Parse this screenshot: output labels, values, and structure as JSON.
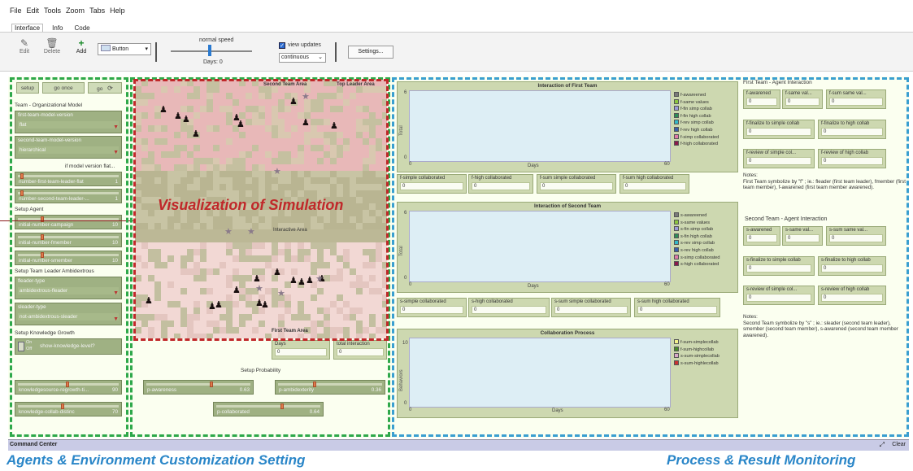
{
  "menu": [
    "File",
    "Edit",
    "Tools",
    "Zoom",
    "Tabs",
    "Help"
  ],
  "tabs": [
    "Interface",
    "Info",
    "Code"
  ],
  "toolbar": {
    "edit": "Edit",
    "delete": "Delete",
    "add": "Add",
    "widget_type": "Button",
    "speed_label": "normal speed",
    "days_label": "Days: 0",
    "view_updates": "view updates",
    "update_mode": "continuous",
    "settings": "Settings..."
  },
  "controls": {
    "setup": "setup",
    "go_once": "go once",
    "go": "go",
    "org_model_title": "Team - Organizational Model",
    "first_team_model": {
      "label": "first-team-model-version",
      "value": "flat"
    },
    "second_team_model": {
      "label": "second-team-model-version",
      "value": "hierarchical"
    },
    "if_flat_note": "if model version flat...",
    "slider_leader_flat": {
      "label": "number-first-team-leader-flat",
      "value": "1",
      "level": 0.05
    },
    "slider_second_leader": {
      "label": "number-second-team-leader-...",
      "value": "1",
      "level": 0.05
    },
    "setup_agent_title": "Setup Agent",
    "slider_campaign": {
      "label": "initial-number-campaign",
      "value": "10",
      "level": 0.25
    },
    "slider_fmember": {
      "label": "initial-number-fmember",
      "value": "10",
      "level": 0.25
    },
    "slider_smember": {
      "label": "initial-number-smember",
      "value": "10",
      "level": 0.25
    },
    "ambidextrous_title": "Setup Team Leader Ambidextrous",
    "fleader_type": {
      "label": "fleader-type",
      "value": "ambidextrous-fleader"
    },
    "sleader_type": {
      "label": "sleader-type",
      "value": "not-ambidextrous-sleader"
    },
    "knowledge_title": "Setup Knowledge Growth",
    "switch_on": "On",
    "switch_off": "Off",
    "show_knowledge": "show-knowledge-level?",
    "slider_regrowth": {
      "label": "knowledgesource-regrowth-ti...",
      "value": "90",
      "level": 0.5
    },
    "slider_distinc": {
      "label": "knowledge-collab-distinc",
      "value": "70",
      "level": 0.45
    }
  },
  "world": {
    "second_area": "Second Team Area",
    "top_leader": "Top Leader Area",
    "interactive": "Interactive Area",
    "first_area": "First Team Area",
    "overlay": "Visualization of Simulation"
  },
  "probability": {
    "days_label": "Days",
    "days_value": "0",
    "total_label": "total interaction",
    "total_value": "0",
    "title": "Setup Probability",
    "p_awareness": {
      "label": "p-awareness",
      "value": "0.63",
      "level": 0.63
    },
    "p_ambidexterity": {
      "label": "p-ambidexterity",
      "value": "0.36",
      "level": 0.36
    },
    "p_collaborated": {
      "label": "p-collaborated",
      "value": "0.64",
      "level": 0.64
    }
  },
  "plot1": {
    "title": "Interaction of First Team",
    "ylabel": "Total",
    "xlabel": "Days",
    "ymax": "6",
    "ymin": "0",
    "xmin": "0",
    "xmax": "60",
    "legend": [
      {
        "name": "f-awareened",
        "color": "#7a7a7a"
      },
      {
        "name": "f-same values",
        "color": "#8cc63f"
      },
      {
        "name": "f-fin simp collab",
        "color": "#9a9ad8"
      },
      {
        "name": "f-fin high collab",
        "color": "#2e8b57"
      },
      {
        "name": "f-rev simp collab",
        "color": "#35b8c8"
      },
      {
        "name": "f-rev high collab",
        "color": "#3a5fa8"
      },
      {
        "name": "f-simp collaborated",
        "color": "#e07aa8"
      },
      {
        "name": "f-high collaborated",
        "color": "#8b1a4a"
      }
    ]
  },
  "monitors1": [
    {
      "label": "f-simple collaborated",
      "value": "0"
    },
    {
      "label": "f-high collaborated",
      "value": "0"
    },
    {
      "label": "f-sum simple collaborated",
      "value": "0"
    },
    {
      "label": "f-sum high collaborated",
      "value": "0"
    }
  ],
  "plot2": {
    "title": "Interaction of Second Team",
    "ylabel": "Total",
    "xlabel": "Days",
    "ymax": "6",
    "ymin": "0",
    "xmin": "0",
    "xmax": "60",
    "legend": [
      {
        "name": "s-awareened",
        "color": "#7a7a7a"
      },
      {
        "name": "s-same values",
        "color": "#8cc63f"
      },
      {
        "name": "s-fin simp collab",
        "color": "#9a9ad8"
      },
      {
        "name": "s-fin high collab",
        "color": "#2e8b57"
      },
      {
        "name": "s-rev simp collab",
        "color": "#35b8c8"
      },
      {
        "name": "s-rev high collab",
        "color": "#3a5fa8"
      },
      {
        "name": "s-simp collaborated",
        "color": "#e07aa8"
      },
      {
        "name": "s-high collaborated",
        "color": "#8b1a4a"
      }
    ]
  },
  "monitors2": [
    {
      "label": "s-simple collaborated",
      "value": "0"
    },
    {
      "label": "s-high collaborated",
      "value": "0"
    },
    {
      "label": "s-sum simple collaborated",
      "value": "0"
    },
    {
      "label": "s-sum high collaborated",
      "value": "0"
    }
  ],
  "plot3": {
    "title": "Collaboration Process",
    "ylabel": "Behaviors",
    "xlabel": "Days",
    "ymax": "10",
    "ymin": "0",
    "xmin": "0",
    "xmax": "60",
    "legend": [
      {
        "name": "f-sum-simplecollab",
        "color": "#f2f28c"
      },
      {
        "name": "f-sum-highcollab",
        "color": "#4a8c2a"
      },
      {
        "name": "s-sum-simplecollab",
        "color": "#d8a8c8"
      },
      {
        "name": "s-sum-highlecollab",
        "color": "#c83232"
      }
    ]
  },
  "first_interaction": {
    "title": "First Team - Agent Interaction",
    "row1": [
      {
        "label": "f-awarened",
        "value": "0"
      },
      {
        "label": "f-same val...",
        "value": "0"
      },
      {
        "label": "f-sum same val...",
        "value": "0"
      }
    ],
    "row2": [
      {
        "label": "f-finalize to simple collab",
        "value": "0"
      },
      {
        "label": "f-finalize to high collab",
        "value": "0"
      }
    ],
    "row3": [
      {
        "label": "f-review of simple col...",
        "value": "0"
      },
      {
        "label": "f-review of high collab",
        "value": "0"
      }
    ],
    "notes_title": "Notes:",
    "notes": "First Team symbolize by \"f\" ; ie.: fleader (first team leader), fmember (first team member), f-awarened (first team member awarened)."
  },
  "second_interaction": {
    "title": "Second Team - Agent Interaction",
    "row1": [
      {
        "label": "s-awarened",
        "value": "0"
      },
      {
        "label": "s-same val...",
        "value": "0"
      },
      {
        "label": "s-sum same val...",
        "value": "0"
      }
    ],
    "row2": [
      {
        "label": "s-finalize to simple collab",
        "value": "0"
      },
      {
        "label": "s-finalize to high collab",
        "value": "0"
      }
    ],
    "row3": [
      {
        "label": "s-review of simple col...",
        "value": "0"
      },
      {
        "label": "s-review of high collab",
        "value": "0"
      }
    ],
    "notes_title": "Notes:",
    "notes": "Second Team symbolize by \"s\" ; ie.: sleader (second team leader), smember (second team member), s-awarened (second team member awarened)."
  },
  "command_center": {
    "title": "Command Center",
    "clear": "Clear"
  },
  "captions": {
    "left": "Agents & Environment Customization Setting",
    "right": "Process & Result Monitoring"
  },
  "colors": {
    "green_dash": "#2ea84a",
    "blue_dash": "#3a9fd0",
    "red_dash": "#c0282a",
    "caption": "#2a86c8"
  }
}
